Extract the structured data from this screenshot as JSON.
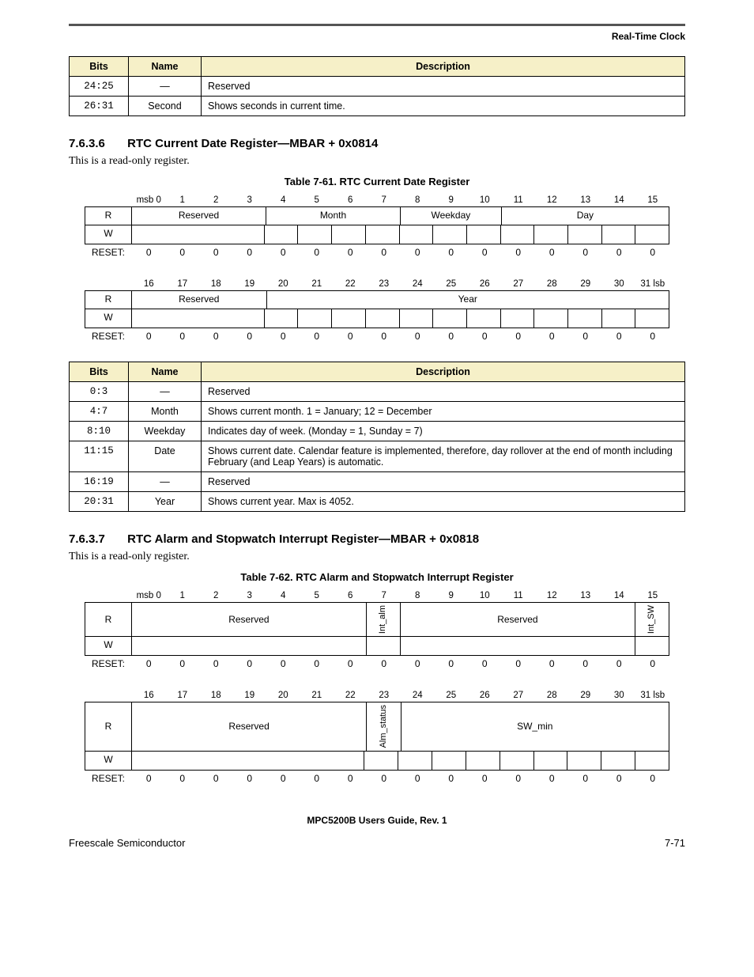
{
  "chapter_title": "Real-Time Clock",
  "frag_table_top": {
    "headers": [
      "Bits",
      "Name",
      "Description"
    ],
    "rows": [
      {
        "bits": "24:25",
        "name": "—",
        "desc": "Reserved"
      },
      {
        "bits": "26:31",
        "name": "Second",
        "desc": "Shows seconds in current time."
      }
    ]
  },
  "sec_7636": {
    "num": "7.6.3.6",
    "title": "RTC Current Date Register—MBAR + 0x0814",
    "para": "This is a read-only register.",
    "caption": "Table 7-61. RTC Current Date Register"
  },
  "bitlayout_61_top": {
    "bits": [
      "msb 0",
      "1",
      "2",
      "3",
      "4",
      "5",
      "6",
      "7",
      "8",
      "9",
      "10",
      "11",
      "12",
      "13",
      "14",
      "15"
    ],
    "r": "R",
    "w": "W",
    "reset_label": "RESET:",
    "fields": [
      {
        "span": 4,
        "label": "Reserved"
      },
      {
        "span": 4,
        "label": "Month"
      },
      {
        "span": 3,
        "label": "Weekday"
      },
      {
        "span": 5,
        "label": "Day"
      }
    ],
    "reset": [
      "0",
      "0",
      "0",
      "0",
      "0",
      "0",
      "0",
      "0",
      "0",
      "0",
      "0",
      "0",
      "0",
      "0",
      "0",
      "0"
    ]
  },
  "bitlayout_61_bot": {
    "bits": [
      "16",
      "17",
      "18",
      "19",
      "20",
      "21",
      "22",
      "23",
      "24",
      "25",
      "26",
      "27",
      "28",
      "29",
      "30",
      "31 lsb"
    ],
    "r": "R",
    "w": "W",
    "reset_label": "RESET:",
    "fields": [
      {
        "span": 4,
        "label": "Reserved"
      },
      {
        "span": 12,
        "label": "Year"
      }
    ],
    "reset": [
      "0",
      "0",
      "0",
      "0",
      "0",
      "0",
      "0",
      "0",
      "0",
      "0",
      "0",
      "0",
      "0",
      "0",
      "0",
      "0"
    ]
  },
  "desc_table_61": {
    "headers": [
      "Bits",
      "Name",
      "Description"
    ],
    "rows": [
      {
        "bits": "0:3",
        "name": "—",
        "desc": "Reserved"
      },
      {
        "bits": "4:7",
        "name": "Month",
        "desc": "Shows current month. 1 = January; 12 = December"
      },
      {
        "bits": "8:10",
        "name": "Weekday",
        "desc": "Indicates day of week. (Monday = 1, Sunday = 7)"
      },
      {
        "bits": "11:15",
        "name": "Date",
        "desc": "Shows current date. Calendar feature is implemented, therefore, day rollover at the end of month including February (and Leap Years) is automatic."
      },
      {
        "bits": "16:19",
        "name": "—",
        "desc": "Reserved"
      },
      {
        "bits": "20:31",
        "name": "Year",
        "desc": "Shows current year. Max is 4052."
      }
    ]
  },
  "sec_7637": {
    "num": "7.6.3.7",
    "title": "RTC Alarm and Stopwatch Interrupt Register—MBAR + 0x0818",
    "para": "This is a read-only register.",
    "caption": "Table 7-62. RTC Alarm and Stopwatch Interrupt Register"
  },
  "bitlayout_62_top": {
    "bits": [
      "msb 0",
      "1",
      "2",
      "3",
      "4",
      "5",
      "6",
      "7",
      "8",
      "9",
      "10",
      "11",
      "12",
      "13",
      "14",
      "15"
    ],
    "r": "R",
    "w": "W",
    "reset_label": "RESET:",
    "fields": [
      {
        "span": 7,
        "label": "Reserved"
      },
      {
        "span": 1,
        "label": "Int_alm",
        "vertical": true
      },
      {
        "span": 7,
        "label": "Reserved"
      },
      {
        "span": 1,
        "label": "Int_SW",
        "vertical": true
      }
    ],
    "reset": [
      "0",
      "0",
      "0",
      "0",
      "0",
      "0",
      "0",
      "0",
      "0",
      "0",
      "0",
      "0",
      "0",
      "0",
      "0",
      "0"
    ]
  },
  "bitlayout_62_bot": {
    "bits": [
      "16",
      "17",
      "18",
      "19",
      "20",
      "21",
      "22",
      "23",
      "24",
      "25",
      "26",
      "27",
      "28",
      "29",
      "30",
      "31 lsb"
    ],
    "r": "R",
    "w": "W",
    "reset_label": "RESET:",
    "fields": [
      {
        "span": 7,
        "label": "Reserved"
      },
      {
        "span": 1,
        "label": "Alm_status",
        "vertical": true
      },
      {
        "span": 8,
        "label": "SW_min"
      }
    ],
    "reset": [
      "0",
      "0",
      "0",
      "0",
      "0",
      "0",
      "0",
      "0",
      "0",
      "0",
      "0",
      "0",
      "0",
      "0",
      "0",
      "0"
    ]
  },
  "footer": {
    "center": "MPC5200B Users Guide, Rev. 1",
    "left": "Freescale Semiconductor",
    "right": "7-71"
  }
}
